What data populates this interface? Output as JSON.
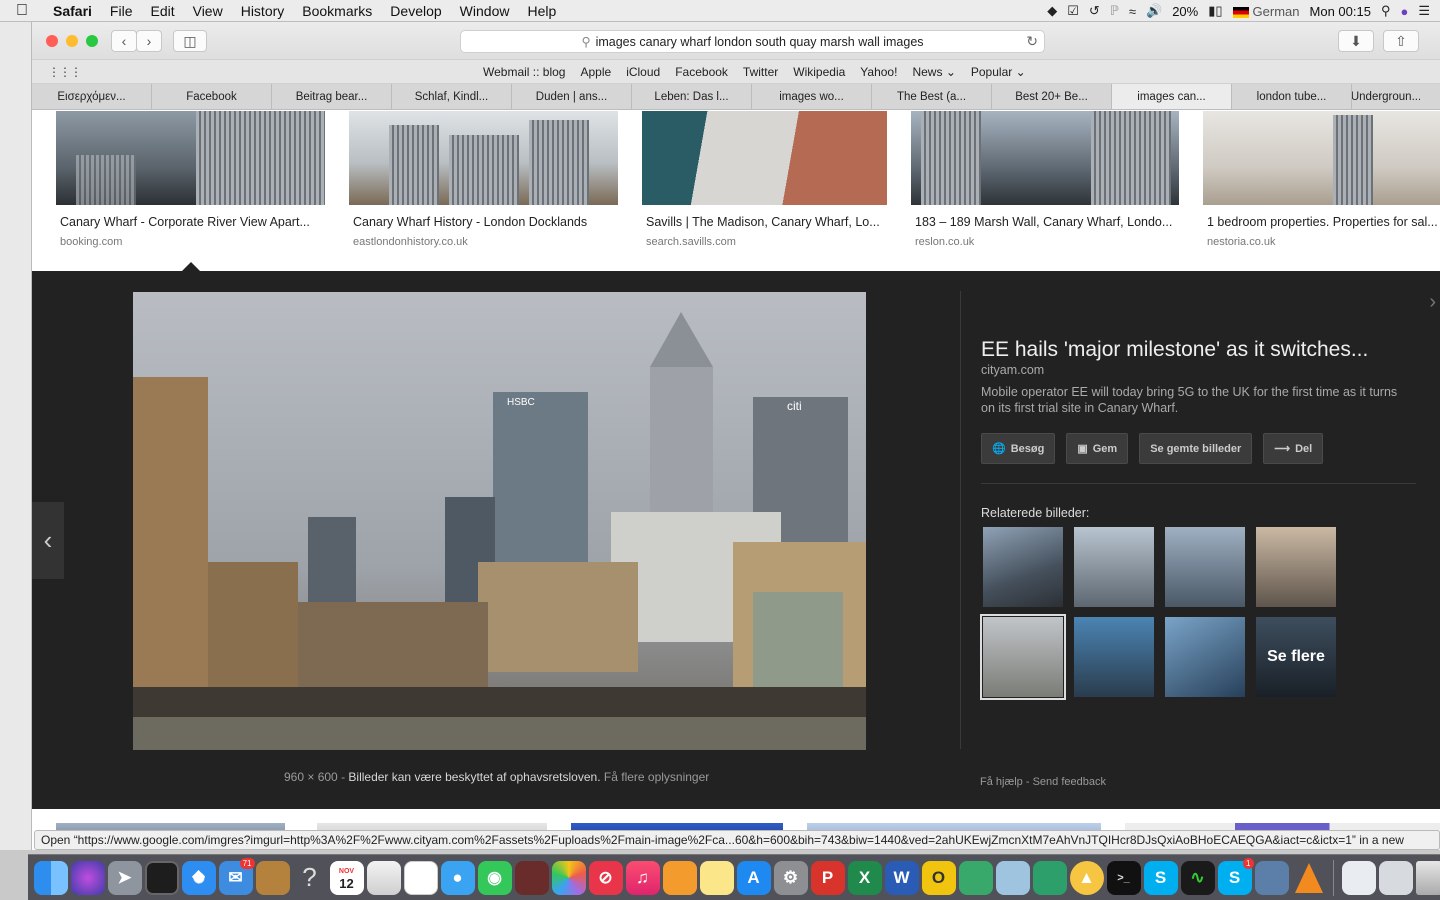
{
  "menubar": {
    "app": "Safari",
    "items": [
      "File",
      "Edit",
      "View",
      "History",
      "Bookmarks",
      "Develop",
      "Window",
      "Help"
    ],
    "battery": "20%",
    "input_source": "German",
    "clock": "Mon 00:15"
  },
  "browser": {
    "url": "images canary wharf london south quay marsh wall images",
    "favorites": [
      "Webmail :: blog",
      "Apple",
      "iCloud",
      "Facebook",
      "Twitter",
      "Wikipedia",
      "Yahoo!",
      "News",
      "Popular"
    ],
    "tabs": [
      {
        "label": "Εισερχόμεν..."
      },
      {
        "label": "Facebook"
      },
      {
        "label": "Beitrag bear..."
      },
      {
        "label": "Schlaf, Kindl..."
      },
      {
        "label": "Duden | ans..."
      },
      {
        "label": "Leben: Das l..."
      },
      {
        "label": "images wo..."
      },
      {
        "label": "The Best (a..."
      },
      {
        "label": "Best 20+ Be..."
      },
      {
        "label": "images can...",
        "active": true
      },
      {
        "label": "london tube..."
      },
      {
        "label": "Undergroun..."
      }
    ]
  },
  "results": [
    {
      "caption": "Canary Wharf - Corporate River View Apart...",
      "source": "booking.com"
    },
    {
      "caption": "Canary Wharf History - London Docklands",
      "source": "eastlondonhistory.co.uk"
    },
    {
      "caption": "Savills | The Madison, Canary Wharf, Lo...",
      "source": "search.savills.com"
    },
    {
      "caption": "183 – 189 Marsh Wall, Canary Wharf, Londo...",
      "source": "reslon.co.uk"
    },
    {
      "caption": "1 bedroom properties. Properties for sal...",
      "source": "nestoria.co.uk"
    }
  ],
  "preview": {
    "dimensions": "960 × 600",
    "separator": "-",
    "copyright": "Billeder kan være beskyttet af ophavsretsloven.",
    "more_info": "Få flere oplysninger",
    "title": "EE hails 'major milestone' as it switches...",
    "site": "cityam.com",
    "description": "Mobile operator EE will today bring 5G to the UK for the first time as it turns on its first trial site in Canary Wharf.",
    "buttons": {
      "visit": "Besøg",
      "save": "Gem",
      "saved": "Se gemte billeder",
      "share": "Del"
    },
    "related_label": "Relaterede billeder:",
    "see_more": "Se flere",
    "help": "Få hjælp",
    "feedback": "Send feedback",
    "help_sep": "-"
  },
  "status_url": "Open “https://www.google.com/imgres?imgurl=http%3A%2F%2Fwww.cityam.com%2Fassets%2Fuploads%2Fmain-image%2Fca...60&h=600&bih=743&biw=1440&ved=2ahUKEwjZmcnXtM7eAhVnJTQIHcr8DJsQxiAoBHoECAEQGA&iact=c&ictx=1” in a new",
  "dock": {
    "calendar_month": "NOV",
    "calendar_day": "12",
    "mail_badge": "71",
    "skype_badge": "1"
  },
  "colors": {
    "panel_bg": "#222222",
    "accent_red": "#ff5f57",
    "accent_yellow": "#febc2e",
    "accent_green": "#28c840"
  }
}
